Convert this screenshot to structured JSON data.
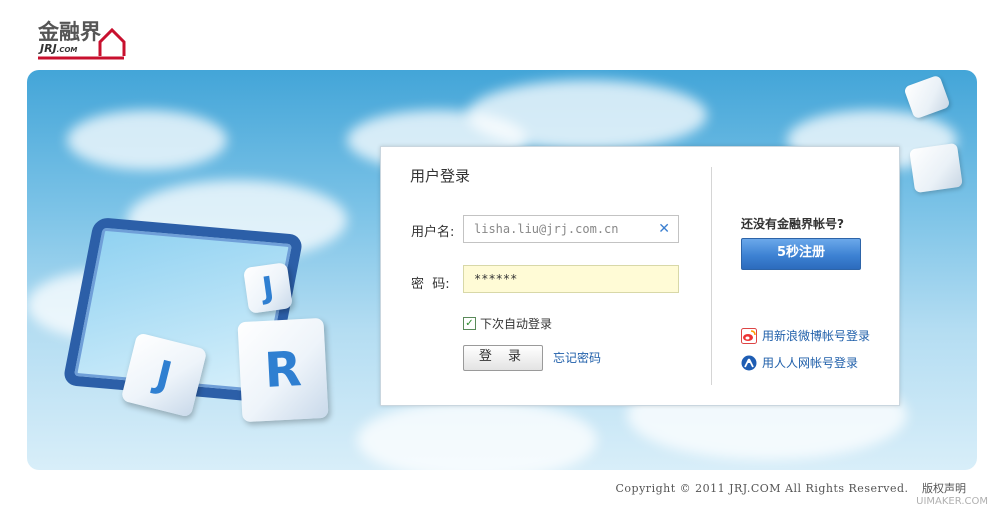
{
  "logo": {
    "cn": "金融界",
    "en": "JRJ",
    "en_suffix": ".COM"
  },
  "login": {
    "title": "用户登录",
    "username_label": "用户名:",
    "username_value": "lisha.liu@jrj.com.cn",
    "password_label": "密  码:",
    "password_value": "******",
    "remember_label": "下次自动登录",
    "remember_checked": true,
    "login_button": "登 录",
    "forgot_link": "忘记密码"
  },
  "register": {
    "prompt": "还没有金融界帐号?",
    "button": "5秒注册"
  },
  "sso": {
    "weibo": "用新浪微博帐号登录",
    "renren": "用人人网帐号登录"
  },
  "footer": {
    "copyright": "Copyright © 2011 JRJ.COM All Rights Reserved.",
    "rights": "版权声明",
    "watermark": "UIMAKER.COM"
  },
  "colors": {
    "link": "#1f5faa",
    "register_button": "#3d82d3",
    "password_bg": "#fffbd6"
  },
  "icons": {
    "clear": "close-icon",
    "weibo": "weibo-icon",
    "renren": "renren-icon",
    "checkbox": "check-icon"
  }
}
